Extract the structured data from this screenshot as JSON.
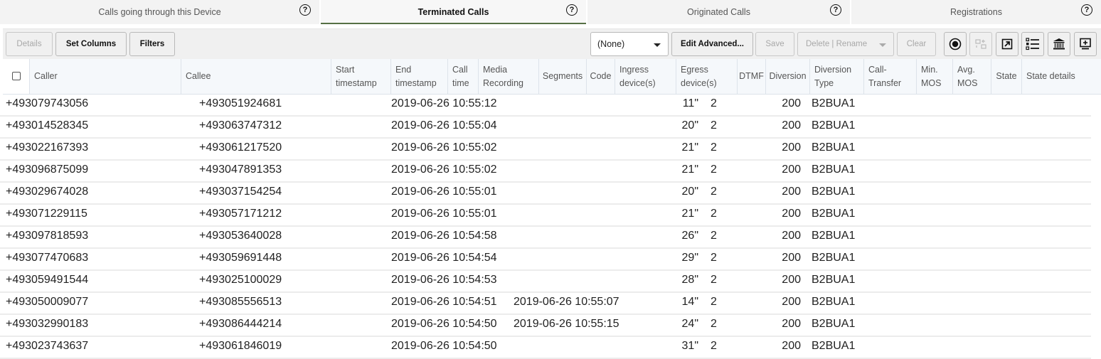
{
  "tabs": [
    {
      "label": "Calls going through this Device",
      "active": false,
      "help": "?"
    },
    {
      "label": "Terminated Calls",
      "active": true,
      "help": "?"
    },
    {
      "label": "Originated Calls",
      "active": false,
      "help": "?"
    },
    {
      "label": "Registrations",
      "active": false,
      "help": "?"
    }
  ],
  "toolbar": {
    "details_label": "Details",
    "set_columns_label": "Set Columns",
    "filters_label": "Filters",
    "filter_select_value": "(None)",
    "edit_advanced_label": "Edit Advanced...",
    "save_label": "Save",
    "delete_rename_label": "Delete | Rename",
    "clear_label": "Clear",
    "icons": [
      "record-icon",
      "compare-icon",
      "export-icon",
      "list-icon",
      "bank-icon",
      "add-screen-icon"
    ]
  },
  "columns": [
    {
      "key": "caller",
      "label": "Caller"
    },
    {
      "key": "callee",
      "label": "Callee"
    },
    {
      "key": "start",
      "label": "Start timestamp"
    },
    {
      "key": "end",
      "label": "End timestamp"
    },
    {
      "key": "call_time",
      "label": "Call time"
    },
    {
      "key": "media",
      "label": "Media Recording"
    },
    {
      "key": "segments",
      "label": "Segments"
    },
    {
      "key": "code",
      "label": "Code"
    },
    {
      "key": "ingress",
      "label": "Ingress device(s)"
    },
    {
      "key": "egress",
      "label": "Egress device(s)"
    },
    {
      "key": "dtmf",
      "label": "DTMF"
    },
    {
      "key": "diversion",
      "label": "Diversion"
    },
    {
      "key": "diversion_type",
      "label": "Diversion Type"
    },
    {
      "key": "call_transfer",
      "label": "Call-Transfer"
    },
    {
      "key": "min_mos",
      "label": "Min. MOS"
    },
    {
      "key": "avg_mos",
      "label": "Avg. MOS"
    },
    {
      "key": "state",
      "label": "State"
    },
    {
      "key": "state_details",
      "label": "State details"
    }
  ],
  "rows": [
    {
      "caller": "+493079743056",
      "callee": "+493051924681",
      "start": "2019-06-26 10:55:12",
      "end": "",
      "call_time": "11\"",
      "segments": "2",
      "code": "200",
      "diversion": "B2BUA1"
    },
    {
      "caller": "+493014528345",
      "callee": "+493063747312",
      "start": "2019-06-26 10:55:04",
      "end": "",
      "call_time": "20\"",
      "segments": "2",
      "code": "200",
      "diversion": "B2BUA1"
    },
    {
      "caller": "+493022167393",
      "callee": "+493061217520",
      "start": "2019-06-26 10:55:02",
      "end": "",
      "call_time": "21\"",
      "segments": "2",
      "code": "200",
      "diversion": "B2BUA1"
    },
    {
      "caller": "+493096875099",
      "callee": "+493047891353",
      "start": "2019-06-26 10:55:02",
      "end": "",
      "call_time": "21\"",
      "segments": "2",
      "code": "200",
      "diversion": "B2BUA1"
    },
    {
      "caller": "+493029674028",
      "callee": "+493037154254",
      "start": "2019-06-26 10:55:01",
      "end": "",
      "call_time": "20\"",
      "segments": "2",
      "code": "200",
      "diversion": "B2BUA1"
    },
    {
      "caller": "+493071229115",
      "callee": "+493057171212",
      "start": "2019-06-26 10:55:01",
      "end": "",
      "call_time": "21\"",
      "segments": "2",
      "code": "200",
      "diversion": "B2BUA1"
    },
    {
      "caller": "+493097818593",
      "callee": "+493053640028",
      "start": "2019-06-26 10:54:58",
      "end": "",
      "call_time": "26\"",
      "segments": "2",
      "code": "200",
      "diversion": "B2BUA1"
    },
    {
      "caller": "+493077470683",
      "callee": "+493059691448",
      "start": "2019-06-26 10:54:54",
      "end": "",
      "call_time": "29\"",
      "segments": "2",
      "code": "200",
      "diversion": "B2BUA1"
    },
    {
      "caller": "+493059491544",
      "callee": "+493025100029",
      "start": "2019-06-26 10:54:53",
      "end": "",
      "call_time": "28\"",
      "segments": "2",
      "code": "200",
      "diversion": "B2BUA1"
    },
    {
      "caller": "+493050009077",
      "callee": "+493085556513",
      "start": "2019-06-26 10:54:51",
      "end": "2019-06-26 10:55:07",
      "call_time": "14\"",
      "segments": "2",
      "code": "200",
      "diversion": "B2BUA1"
    },
    {
      "caller": "+493032990183",
      "callee": "+493086444214",
      "start": "2019-06-26 10:54:50",
      "end": "2019-06-26 10:55:15",
      "call_time": "24\"",
      "segments": "2",
      "code": "200",
      "diversion": "B2BUA1"
    },
    {
      "caller": "+493023743637",
      "callee": "+493061846019",
      "start": "2019-06-26 10:54:50",
      "end": "",
      "call_time": "31\"",
      "segments": "2",
      "code": "200",
      "diversion": "B2BUA1"
    }
  ],
  "colors": {
    "active_tab_underline": "#567045",
    "header_bg": "#f5f8fb"
  }
}
